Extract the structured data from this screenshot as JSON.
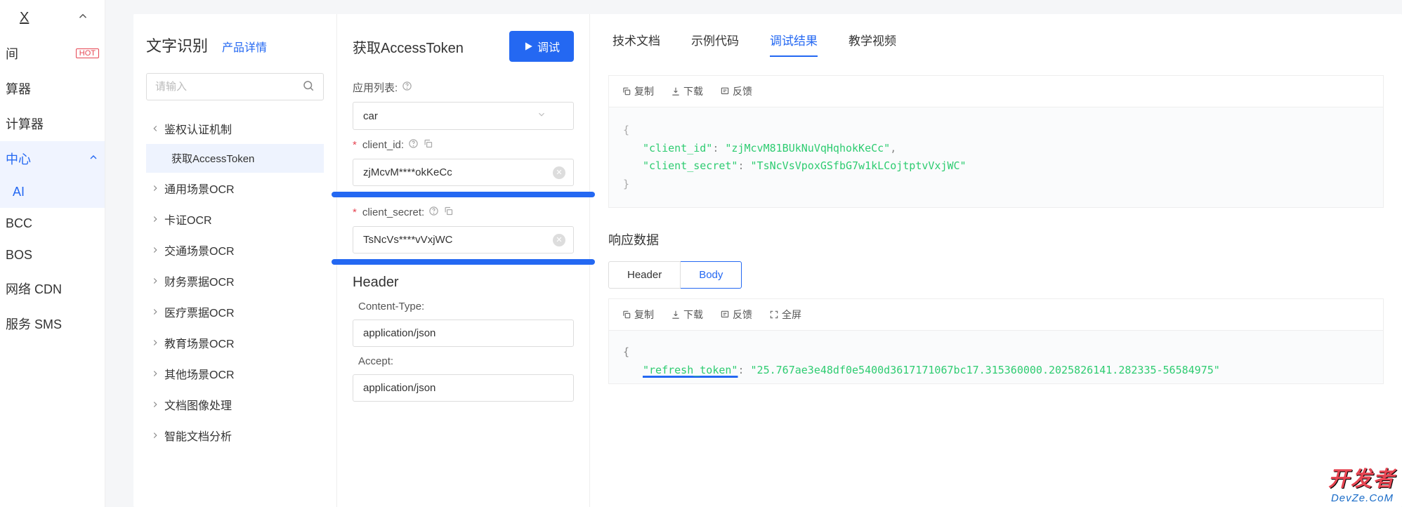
{
  "leftNav": {
    "top_x": "X",
    "items": [
      {
        "label": "间",
        "hot": "HOT"
      },
      {
        "label": "算器"
      },
      {
        "label": "计算器"
      },
      {
        "label": "中心",
        "active": true,
        "expandable": true
      },
      {
        "label": "AI",
        "sub": true,
        "active": true
      },
      {
        "label": "BCC"
      },
      {
        "label": "BOS"
      },
      {
        "label": "网络 CDN"
      },
      {
        "label": "服务 SMS"
      }
    ]
  },
  "tree": {
    "title": "文字识别",
    "detail_link": "产品详情",
    "search_placeholder": "请输入",
    "groups": [
      {
        "label": "鉴权认证机制",
        "expanded": true,
        "children": [
          {
            "label": "获取AccessToken",
            "active": true
          }
        ]
      },
      {
        "label": "通用场景OCR"
      },
      {
        "label": "卡证OCR"
      },
      {
        "label": "交通场景OCR"
      },
      {
        "label": "财务票据OCR"
      },
      {
        "label": "医疗票据OCR"
      },
      {
        "label": "教育场景OCR"
      },
      {
        "label": "其他场景OCR"
      },
      {
        "label": "文档图像处理"
      },
      {
        "label": "智能文档分析"
      }
    ]
  },
  "form": {
    "title": "获取AccessToken",
    "debug_btn": "调试",
    "app_list_label": "应用列表:",
    "app_list_value": "car",
    "client_id_label": "client_id:",
    "client_id_value": "zjMcvM****okKeCc",
    "client_secret_label": "client_secret:",
    "client_secret_value": "TsNcVs****vVxjWC",
    "header_section": "Header",
    "content_type_label": "Content-Type:",
    "content_type_value": "application/json",
    "accept_label": "Accept:",
    "accept_value": "application/json"
  },
  "result": {
    "tabs": [
      "技术文档",
      "示例代码",
      "调试结果",
      "教学视频"
    ],
    "active_tab": 2,
    "toolbar": {
      "copy": "复制",
      "download": "下载",
      "feedback": "反馈",
      "fullscreen": "全屏"
    },
    "request_json": {
      "client_id_key": "\"client_id\"",
      "client_id_val": "\"zjMcvM81BUkNuVqHqhokKeCc\"",
      "client_secret_key": "\"client_secret\"",
      "client_secret_val": "\"TsNcVsVpoxGSfbG7w1kLCojtptvVxjWC\""
    },
    "response_title": "响应数据",
    "seg_header": "Header",
    "seg_body": "Body",
    "response_json": {
      "refresh_token_key": "\"refresh_token\"",
      "refresh_token_val": "\"25.767ae3e48df0e5400d3617171067bc17.315360000.2025826141.282335-56584975\""
    }
  },
  "watermark": {
    "top": "开发者",
    "bot": "DevZe.CoM"
  }
}
